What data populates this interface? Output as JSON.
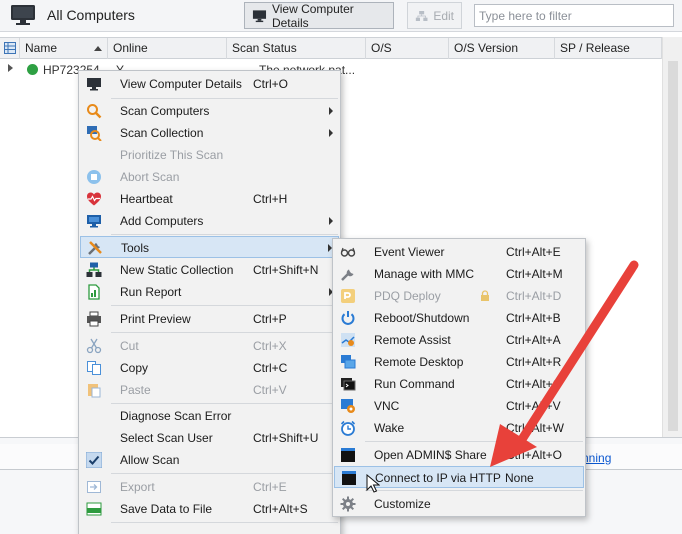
{
  "toolbar": {
    "title": "All Computers",
    "view_button": "View Computer Details",
    "edit_button": "Edit",
    "filter_placeholder": "Type here to filter"
  },
  "grid": {
    "columns": [
      "Name",
      "Online",
      "Scan Status",
      "O/S",
      "O/S Version",
      "SP / Release"
    ],
    "rows": [
      {
        "name": "HP723254",
        "online": "Y",
        "scan_status": "The network pat..."
      }
    ]
  },
  "status": {
    "link_text": "nning"
  },
  "main_menu": [
    {
      "label": "View Computer Details",
      "shortcut": "Ctrl+O",
      "icon": "monitor-icon"
    },
    {
      "label": "Scan Computers",
      "shortcut": "",
      "icon": "magnifier-icon",
      "submenu": true
    },
    {
      "label": "Scan Collection",
      "shortcut": "",
      "icon": "scan-collection-icon",
      "submenu": true
    },
    {
      "label": "Prioritize This Scan",
      "shortcut": "",
      "disabled": true
    },
    {
      "label": "Abort Scan",
      "shortcut": "",
      "icon": "abort-icon",
      "disabled": true
    },
    {
      "label": "Heartbeat",
      "shortcut": "Ctrl+H",
      "icon": "heartbeat-icon"
    },
    {
      "label": "Add Computers",
      "shortcut": "",
      "icon": "add-computer-icon",
      "submenu": true
    },
    {
      "label": "Tools",
      "shortcut": "",
      "icon": "tools-icon",
      "submenu": true,
      "highlight": true
    },
    {
      "label": "New Static Collection",
      "shortcut": "Ctrl+Shift+N",
      "icon": "collection-icon"
    },
    {
      "label": "Run Report",
      "shortcut": "",
      "icon": "report-icon",
      "submenu": true
    },
    {
      "label": "Print Preview",
      "shortcut": "Ctrl+P",
      "icon": "printer-icon"
    },
    {
      "label": "Cut",
      "shortcut": "Ctrl+X",
      "icon": "scissors-icon",
      "disabled": true
    },
    {
      "label": "Copy",
      "shortcut": "Ctrl+C",
      "icon": "copy-icon"
    },
    {
      "label": "Paste",
      "shortcut": "Ctrl+V",
      "icon": "paste-icon",
      "disabled": true
    },
    {
      "label": "Diagnose Scan Error",
      "shortcut": ""
    },
    {
      "label": "Select Scan User",
      "shortcut": "Ctrl+Shift+U"
    },
    {
      "label": "Allow Scan",
      "shortcut": "",
      "icon": "checkmark-icon"
    },
    {
      "label": "Export",
      "shortcut": "Ctrl+E",
      "icon": "export-icon",
      "disabled": true
    },
    {
      "label": "Save Data to File",
      "shortcut": "Ctrl+Alt+S",
      "icon": "csv-icon"
    }
  ],
  "tools_menu": [
    {
      "label": "Event Viewer",
      "shortcut": "Ctrl+Alt+E",
      "icon": "glasses-icon"
    },
    {
      "label": "Manage with MMC",
      "shortcut": "Ctrl+Alt+M",
      "icon": "wrench-icon"
    },
    {
      "label": "PDQ Deploy",
      "shortcut": "Ctrl+Alt+D",
      "icon": "deploy-icon",
      "disabled": true
    },
    {
      "label": "Reboot/Shutdown",
      "shortcut": "Ctrl+Alt+B",
      "icon": "power-icon"
    },
    {
      "label": "Remote Assist",
      "shortcut": "Ctrl+Alt+A",
      "icon": "remote-assist-icon"
    },
    {
      "label": "Remote Desktop",
      "shortcut": "Ctrl+Alt+R",
      "icon": "remote-desktop-icon"
    },
    {
      "label": "Run Command",
      "shortcut": "Ctrl+Alt+C",
      "icon": "terminal-icon"
    },
    {
      "label": "VNC",
      "shortcut": "Ctrl+Alt+V",
      "icon": "vnc-icon"
    },
    {
      "label": "Wake",
      "shortcut": "Ctrl+Alt+W",
      "icon": "alarm-clock-icon"
    },
    {
      "label": "Open ADMIN$ Share",
      "shortcut": "Ctrl+Alt+O",
      "icon": "share-icon"
    },
    {
      "label": "Connect to IP via HTTP",
      "shortcut": "None",
      "icon": "console-icon",
      "highlight": true
    },
    {
      "label": "Customize",
      "shortcut": "",
      "icon": "gear-icon"
    }
  ],
  "colors": {
    "accent_arrow": "#e8413a",
    "highlight": "#d7e6f5",
    "online_green": "#2ea043"
  }
}
